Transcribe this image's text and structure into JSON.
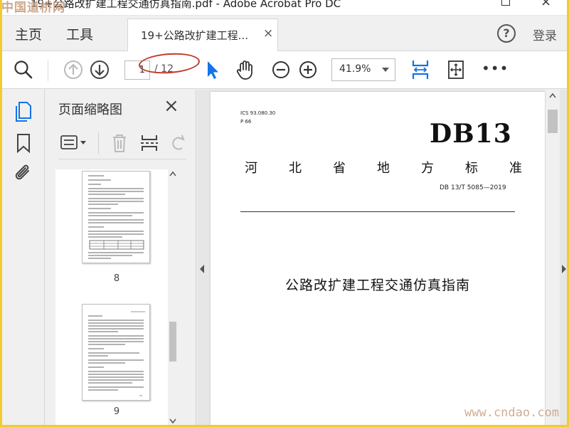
{
  "window": {
    "title": "19+公路改扩建工程交通仿真指南.pdf - Adobe Acrobat Pro DC"
  },
  "watermarks": {
    "top_left": "中国道桥网",
    "bottom_right": "www.cndao.com"
  },
  "menu": {
    "home": "主页",
    "tools": "工具",
    "login": "登录",
    "help_icon": "help-icon"
  },
  "tab": {
    "label": "19+公路改扩建工程...",
    "close": "×"
  },
  "toolbar": {
    "current_page": "1",
    "total_pages": "/ 12",
    "zoom": "41.9%",
    "more": "•••",
    "annotation_color": "#c0392b",
    "accent_color": "#1473e6"
  },
  "panel": {
    "title": "页面缩略图",
    "close": "×",
    "thumbnails": [
      {
        "label": "8"
      },
      {
        "label": "9"
      }
    ]
  },
  "document": {
    "ics": "ICS 93.080.30",
    "p": "P 66",
    "db_code": "DB13",
    "province_chars": [
      "河",
      "北",
      "省",
      "地",
      "方",
      "标",
      "准"
    ],
    "standard_no": "DB 13/T 5085—2019",
    "title": "公路改扩建工程交通仿真指南"
  }
}
